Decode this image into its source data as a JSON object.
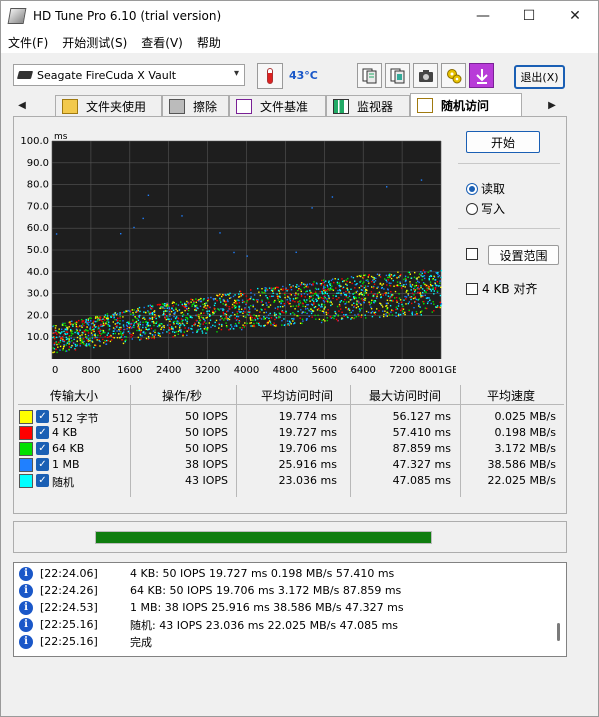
{
  "window": {
    "title": "HD Tune Pro 6.10 (trial version)"
  },
  "menu": [
    "文件(F)",
    "开始测试(S)",
    "查看(V)",
    "帮助"
  ],
  "toolbar": {
    "drive": "Seagate FireCuda X Vault",
    "temperature": "43°C",
    "exit_label": "退出(X)"
  },
  "tabs": [
    {
      "label": "文件夹使用",
      "icon": "folder-icon"
    },
    {
      "label": "擦除",
      "icon": "trash-icon"
    },
    {
      "label": "文件基准",
      "icon": "file-benchmark-icon"
    },
    {
      "label": "监视器",
      "icon": "monitor-chart-icon"
    },
    {
      "label": "随机访问",
      "icon": "random-access-icon",
      "active": true
    }
  ],
  "controls": {
    "start_label": "开始",
    "read_label": "读取",
    "write_label": "写入",
    "read_selected": true,
    "range_label": "设置范围",
    "align_label": "4 KB 对齐"
  },
  "chart_data": {
    "type": "scatter",
    "ylabel": "ms",
    "y_ticks": [
      "100.0",
      "90.0",
      "80.0",
      "70.0",
      "60.0",
      "50.0",
      "40.0",
      "30.0",
      "20.0",
      "10.0"
    ],
    "x_ticks": [
      "0",
      "800",
      "1600",
      "2400",
      "3200",
      "4000",
      "4800",
      "5600",
      "6400",
      "7200",
      "8001GB"
    ],
    "xlim": [
      0,
      8001
    ],
    "ylim": [
      0,
      100
    ],
    "series_colors": [
      "#ffff00",
      "#ff0000",
      "#00e000",
      "#2080ff",
      "#00ffff"
    ],
    "trend": [
      {
        "x": 0,
        "low": 3,
        "high": 16
      },
      {
        "x": 2000,
        "low": 9,
        "high": 25
      },
      {
        "x": 4000,
        "low": 14,
        "high": 32
      },
      {
        "x": 6000,
        "low": 18,
        "high": 38
      },
      {
        "x": 8001,
        "low": 21,
        "high": 42
      }
    ]
  },
  "results": {
    "headers": [
      "传输大小",
      "操作/秒",
      "平均访问时间",
      "最大访问时间",
      "平均速度"
    ],
    "rows": [
      {
        "size": "512 字节",
        "color": "#ffff00",
        "iops": "50 IOPS",
        "avg": "19.774 ms",
        "max": "56.127 ms",
        "speed": "0.025 MB/s"
      },
      {
        "size": "4 KB",
        "color": "#ff0000",
        "iops": "50 IOPS",
        "avg": "19.727 ms",
        "max": "57.410 ms",
        "speed": "0.198 MB/s"
      },
      {
        "size": "64 KB",
        "color": "#00e000",
        "iops": "50 IOPS",
        "avg": "19.706 ms",
        "max": "87.859 ms",
        "speed": "3.172 MB/s"
      },
      {
        "size": "1 MB",
        "color": "#2080ff",
        "iops": "38 IOPS",
        "avg": "25.916 ms",
        "max": "47.327 ms",
        "speed": "38.586 MB/s"
      },
      {
        "size": "随机",
        "color": "#00ffff",
        "iops": "43 IOPS",
        "avg": "23.036 ms",
        "max": "47.085 ms",
        "speed": "22.025 MB/s"
      }
    ]
  },
  "progress": {
    "fraction": 1.0
  },
  "log": [
    {
      "time": "[22:24.06]",
      "text": "4 KB: 50 IOPS 19.727 ms 0.198 MB/s 57.410 ms"
    },
    {
      "time": "[22:24.26]",
      "text": "64 KB: 50 IOPS 19.706 ms 3.172 MB/s 87.859 ms"
    },
    {
      "time": "[22:24.53]",
      "text": "1 MB: 38 IOPS 25.916 ms 38.586 MB/s 47.327 ms"
    },
    {
      "time": "[22:25.16]",
      "text": "随机: 43 IOPS 23.036 ms 22.025 MB/s 47.085 ms"
    },
    {
      "time": "[22:25.16]",
      "text": "完成"
    }
  ]
}
